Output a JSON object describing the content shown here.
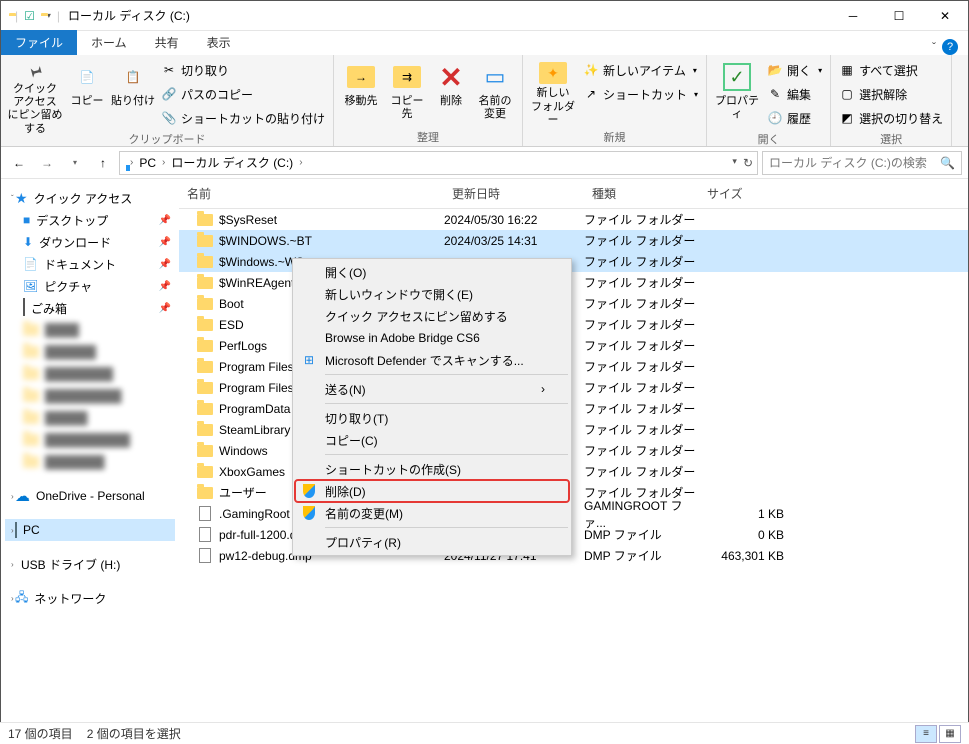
{
  "title": "ローカル ディスク (C:)",
  "tabs": {
    "file": "ファイル",
    "home": "ホーム",
    "share": "共有",
    "view": "表示"
  },
  "ribbon": {
    "clipboard": {
      "label": "クリップボード",
      "quick_access": "クイック アクセス\nにピン留めする",
      "copy": "コピー",
      "paste": "貼り付け",
      "cut": "切り取り",
      "copy_path": "パスのコピー",
      "paste_shortcut": "ショートカットの貼り付け"
    },
    "organize": {
      "label": "整理",
      "move_to": "移動先",
      "copy_to": "コピー先",
      "delete": "削除",
      "rename": "名前の\n変更"
    },
    "new": {
      "label": "新規",
      "new_folder": "新しい\nフォルダー",
      "new_item": "新しいアイテム",
      "shortcut": "ショートカット"
    },
    "open": {
      "label": "開く",
      "properties": "プロパティ",
      "open": "開く",
      "edit": "編集",
      "history": "履歴"
    },
    "select": {
      "label": "選択",
      "select_all": "すべて選択",
      "select_none": "選択解除",
      "invert": "選択の切り替え"
    }
  },
  "breadcrumb": {
    "pc": "PC",
    "drive": "ローカル ディスク (C:)"
  },
  "search_placeholder": "ローカル ディスク (C:)の検索",
  "nav": {
    "quick_access": "クイック アクセス",
    "desktop": "デスクトップ",
    "downloads": "ダウンロード",
    "documents": "ドキュメント",
    "pictures": "ピクチャ",
    "recycle": "ごみ箱",
    "onedrive": "OneDrive - Personal",
    "pc": "PC",
    "usb": "USB ドライブ (H:)",
    "network": "ネットワーク"
  },
  "columns": {
    "name": "名前",
    "date": "更新日時",
    "type": "種類",
    "size": "サイズ"
  },
  "items": [
    {
      "icon": "folder",
      "name": "$SysReset",
      "date": "2024/05/30 16:22",
      "type": "ファイル フォルダー",
      "size": ""
    },
    {
      "icon": "folder",
      "name": "$WINDOWS.~BT",
      "date": "2024/03/25 14:31",
      "type": "ファイル フォルダー",
      "size": "",
      "sel": true
    },
    {
      "icon": "folder",
      "name": "$Windows.~WS",
      "date": "",
      "type": "ファイル フォルダー",
      "size": "",
      "sel": true
    },
    {
      "icon": "folder",
      "name": "$WinREAgent",
      "date": "",
      "type": "ファイル フォルダー",
      "size": ""
    },
    {
      "icon": "folder",
      "name": "Boot",
      "date": "",
      "type": "ファイル フォルダー",
      "size": ""
    },
    {
      "icon": "folder",
      "name": "ESD",
      "date": "",
      "type": "ファイル フォルダー",
      "size": ""
    },
    {
      "icon": "folder",
      "name": "PerfLogs",
      "date": "",
      "type": "ファイル フォルダー",
      "size": ""
    },
    {
      "icon": "folder",
      "name": "Program Files",
      "date": "",
      "type": "ファイル フォルダー",
      "size": ""
    },
    {
      "icon": "folder",
      "name": "Program Files (x86)",
      "date": "",
      "type": "ファイル フォルダー",
      "size": ""
    },
    {
      "icon": "folder",
      "name": "ProgramData",
      "date": "",
      "type": "ファイル フォルダー",
      "size": ""
    },
    {
      "icon": "folder",
      "name": "SteamLibrary",
      "date": "",
      "type": "ファイル フォルダー",
      "size": ""
    },
    {
      "icon": "folder",
      "name": "Windows",
      "date": "",
      "type": "ファイル フォルダー",
      "size": ""
    },
    {
      "icon": "folder",
      "name": "XboxGames",
      "date": "",
      "type": "ファイル フォルダー",
      "size": ""
    },
    {
      "icon": "folder",
      "name": "ユーザー",
      "date": "",
      "type": "ファイル フォルダー",
      "size": ""
    },
    {
      "icon": "file",
      "name": ".GamingRoot",
      "date": "",
      "type": "GAMINGROOT ファ...",
      "size": "1 KB"
    },
    {
      "icon": "file",
      "name": "pdr-full-1200.dmp",
      "date": "",
      "type": "DMP ファイル",
      "size": "0 KB"
    },
    {
      "icon": "file",
      "name": "pw12-debug.dmp",
      "date": "2024/11/27 17:41",
      "type": "DMP ファイル",
      "size": "463,301 KB"
    }
  ],
  "context_menu": {
    "open": "開く(O)",
    "open_new": "新しいウィンドウで開く(E)",
    "pin_qa": "クイック アクセスにピン留めする",
    "bridge": "Browse in Adobe Bridge CS6",
    "defender": "Microsoft Defender でスキャンする...",
    "send_to": "送る(N)",
    "cut": "切り取り(T)",
    "copy": "コピー(C)",
    "shortcut": "ショートカットの作成(S)",
    "delete": "削除(D)",
    "rename": "名前の変更(M)",
    "properties": "プロパティ(R)"
  },
  "status": {
    "count": "17 個の項目",
    "selected": "2 個の項目を選択"
  }
}
